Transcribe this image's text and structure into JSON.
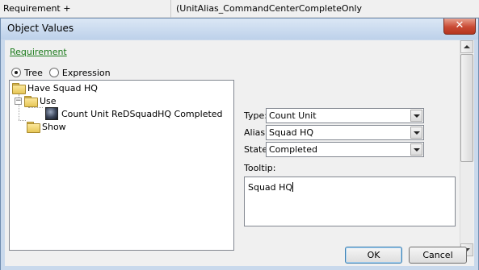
{
  "background": {
    "left_cell": "Requirement +",
    "right_cell": "(UnitAlias_CommandCenterCompleteOnly"
  },
  "dialog": {
    "title": "Object Values",
    "close_glyph": "✕"
  },
  "requirement_link": "Requirement",
  "mode": {
    "tree_label": "Tree",
    "expression_label": "Expression",
    "selected": "Tree"
  },
  "tree": {
    "root": "Have Squad HQ",
    "use": "Use",
    "use_expander": "−",
    "leaf": "Count Unit ReDSquadHQ Completed",
    "show": "Show"
  },
  "fields": {
    "type_label": "Type:",
    "type_value": "Count Unit",
    "alias_label": "Alias:",
    "alias_value": "Squad HQ",
    "state_label": "State:",
    "state_value": "Completed",
    "tooltip_label": "Tooltip:",
    "tooltip_value": "Squad HQ"
  },
  "buttons": {
    "ok": "OK",
    "cancel": "Cancel"
  },
  "icons": {
    "folder": "folder-icon",
    "unit": "unit-portrait-icon",
    "dropdown": "chevron-down-icon",
    "close": "close-icon"
  }
}
